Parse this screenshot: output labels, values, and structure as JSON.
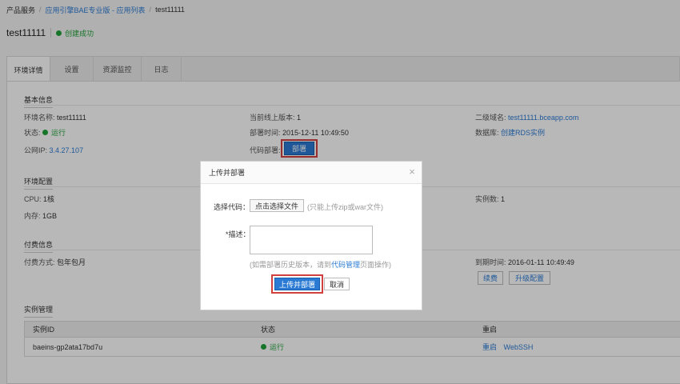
{
  "breadcrumb": {
    "item1": "产品服务",
    "item2": "应用引擎BAE专业版 - 应用列表",
    "item3": "test11111",
    "sep": "/"
  },
  "header": {
    "name": "test11111",
    "status": "创建成功"
  },
  "tabs": [
    {
      "label": "环境详情"
    },
    {
      "label": "设置"
    },
    {
      "label": "资源监控"
    },
    {
      "label": "日志"
    }
  ],
  "basic": {
    "title": "基本信息",
    "env_name_label": "环境名称:",
    "env_name_value": "test11111",
    "online_version_label": "当前线上版本:",
    "online_version_value": "1",
    "domain_label": "二级域名:",
    "domain_value": "test11111.bceapp.com",
    "status_label": "状态:",
    "status_value": "运行",
    "deploy_time_label": "部署时间:",
    "deploy_time_value": "2015-12-11 10:49:50",
    "db_label": "数据库:",
    "db_value": "创建RDS实例",
    "ip_label": "公网IP:",
    "ip_value": "3.4.27.107",
    "code_deploy_label": "代码部署:",
    "deploy_button": "部署"
  },
  "env": {
    "title": "环境配置",
    "cpu_label": "CPU:",
    "cpu_value": "1核",
    "mem_label": "内存:",
    "mem_value": "1GB",
    "instances_label": "实例数:",
    "instances_value": "1"
  },
  "billing": {
    "title": "付费信息",
    "mode_label": "付费方式:",
    "mode_value": "包年包月",
    "expire_label": "到期时间:",
    "expire_value": "2016-01-11 10:49:49",
    "renew_button": "续费",
    "upgrade_button": "升级配置"
  },
  "instances": {
    "title": "实例管理",
    "columns": [
      "实例ID",
      "状态",
      "重启"
    ],
    "rows": [
      {
        "id": "baeins-gp2ata17bd7u",
        "status": "运行",
        "restart": "重启",
        "webssh": "WebSSH"
      }
    ]
  },
  "dialog": {
    "title": "上传并部署",
    "close": "×",
    "code_label": "选择代码：",
    "file_button": "点击选择文件",
    "file_hint": "(只能上传zip或war文件)",
    "desc_label": "*描述：",
    "history_hint_pre": "(如需部署历史版本，请到",
    "history_hint_link": "代码管理",
    "history_hint_post": "页面操作)",
    "upload_button": "上传并部署",
    "cancel_button": "取消"
  },
  "colors": {
    "accent": "#2b7bd4",
    "success": "#21a33a",
    "highlight": "#d23f3f"
  }
}
